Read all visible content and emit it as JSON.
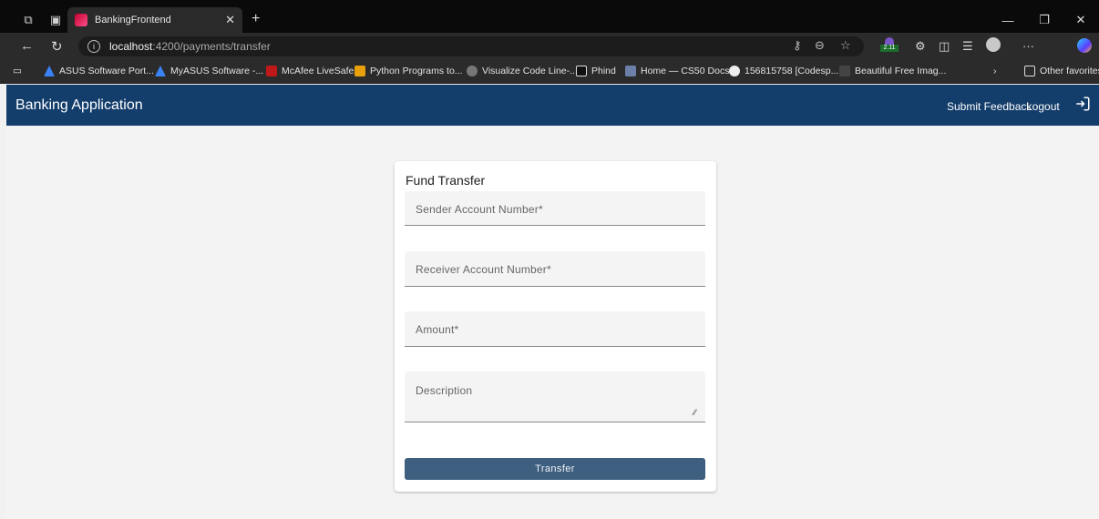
{
  "browser": {
    "tab_title": "BankingFrontend",
    "url_host": "localhost",
    "url_path": ":4200/payments/transfer",
    "bookmarks": [
      "ASUS Software Port...",
      "MyASUS Software -...",
      "McAfee LiveSafe",
      "Python Programs to...",
      "Visualize Code Line-...",
      "Phind",
      "Home — CS50 Docs",
      "156815758 [Codesp...",
      "Beautiful Free Imag..."
    ],
    "other_favorites": "Other favorites",
    "extension_badge": "2.11"
  },
  "app": {
    "title": "Banking Application",
    "nav": {
      "feedback": "Submit Feedback",
      "logout": "Logout"
    },
    "colors": {
      "primary": "#133d6b",
      "button": "#3f5f80"
    }
  },
  "form": {
    "title": "Fund Transfer",
    "fields": {
      "sender": "Sender Account Number*",
      "receiver": "Receiver Account Number*",
      "amount": "Amount*",
      "description": "Description"
    },
    "submit_label": "Transfer"
  }
}
